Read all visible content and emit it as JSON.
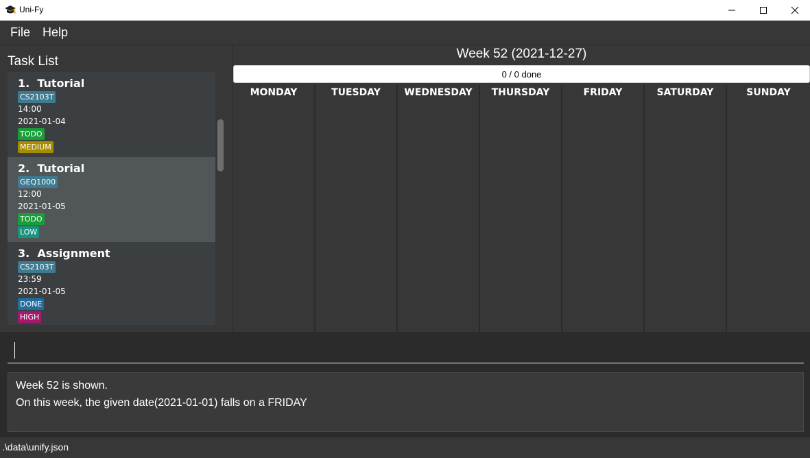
{
  "window": {
    "title": "Uni-Fy",
    "minimize_glyph": "—",
    "maximize_glyph": "☐",
    "close_glyph": "✕"
  },
  "menu": {
    "file": "File",
    "help": "Help"
  },
  "task_panel": {
    "title": "Task List",
    "tasks": [
      {
        "name": "1.  Tutorial",
        "module": "CS2103T",
        "time": "14:00",
        "date": "2021-01-04",
        "status": "TODO",
        "priority": "MEDIUM"
      },
      {
        "name": "2.  Tutorial",
        "module": "GEQ1000",
        "time": "12:00",
        "date": "2021-01-05",
        "status": "TODO",
        "priority": "LOW"
      },
      {
        "name": "3.  Assignment",
        "module": "CS2103T",
        "time": "23:59",
        "date": "2021-01-05",
        "status": "DONE",
        "priority": "HIGH"
      }
    ]
  },
  "calendar": {
    "week_title": "Week 52 (2021-12-27)",
    "progress_text": "0 / 0 done",
    "days": [
      "MONDAY",
      "TUESDAY",
      "WEDNESDAY",
      "THURSDAY",
      "FRIDAY",
      "SATURDAY",
      "SUNDAY"
    ]
  },
  "command": {
    "value": ""
  },
  "result": {
    "line1": "Week 52 is shown.",
    "line2": "On this week, the given date(2021-01-01) falls on a FRIDAY"
  },
  "status": {
    "path": ".\\data\\unify.json"
  },
  "colors": {
    "background": "#2b2b2b",
    "panel": "#373737",
    "todo": "#1a9e3a",
    "done": "#1f6e9e",
    "medium": "#a68c00",
    "low": "#17937e",
    "high": "#a4186d",
    "module": "#3e7b91"
  }
}
